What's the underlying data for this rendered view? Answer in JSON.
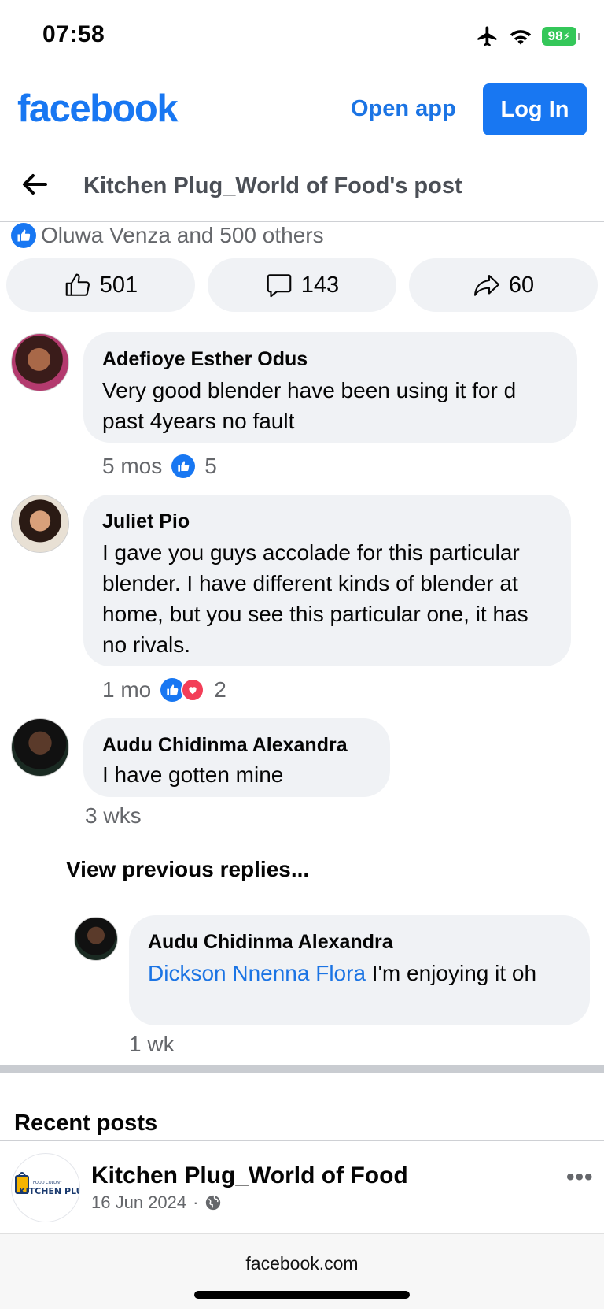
{
  "status_bar": {
    "time": "07:58",
    "battery": "98"
  },
  "header": {
    "logo": "facebook",
    "open_app": "Open app",
    "login": "Log In"
  },
  "nav": {
    "title": "Kitchen Plug_World of Food's post"
  },
  "reactions": {
    "summary": "Oluwa Venza and 500 others"
  },
  "actions": {
    "likes": "501",
    "comments": "143",
    "shares": "60"
  },
  "comments": [
    {
      "author": "Adefioye Esther Odus",
      "text": "Very good blender have been using it for d past 4years no fault",
      "time": "5 mos",
      "reaction_count": "5"
    },
    {
      "author": "Juliet Pio",
      "text": "I gave you guys accolade for this particular blender. I have different kinds of blender at home, but you see this particular one, it has no rivals.",
      "time": "1 mo",
      "reaction_count": "2"
    },
    {
      "author": "Audu Chidinma Alexandra",
      "text": "I have gotten mine",
      "time": "3 wks"
    }
  ],
  "view_previous": "View previous replies...",
  "reply": {
    "author": "Audu Chidinma Alexandra",
    "mention": "Dickson Nnenna Flora",
    "text": " I'm enjoying it oh",
    "time": "1 wk"
  },
  "recent": {
    "title": "Recent posts",
    "page_name": "Kitchen Plug_World of Food",
    "date": "16 Jun 2024",
    "separator": "·",
    "more": "•••",
    "logo_small": "FOOD COLONY",
    "logo_main": "KITCHEN PLUG"
  },
  "bottom": {
    "url": "facebook.com"
  },
  "colors": {
    "brand": "#1877f2",
    "link": "#1b74e4",
    "bubble": "#f0f2f5",
    "love": "#f33e58",
    "battery": "#34c759"
  }
}
